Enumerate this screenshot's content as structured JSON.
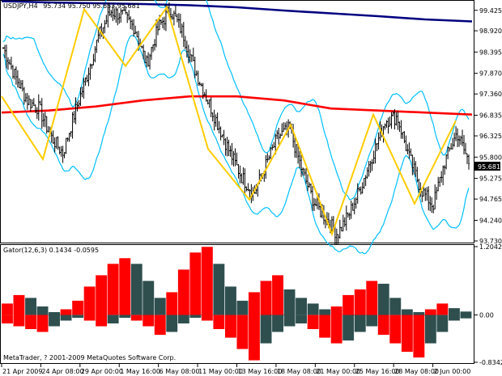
{
  "window": {
    "title": "USDJPY,H4",
    "quote": "95.734 95.750 95.653 95.681",
    "copyright": "MetaTrader, ? 2001-2009 MetaQuotes Software Corp."
  },
  "colors": {
    "background": "#ffffff",
    "bull_bar": "#000000",
    "bear_bar": "#000000",
    "envelope": "#00bfff",
    "slow_ma": "#000080",
    "mid_ma": "#ff0000",
    "zigzag": "#ffcc00",
    "gator_up": "#ff0000",
    "gator_down": "#2f4f4f",
    "price_box": "#000000"
  },
  "price_axis": {
    "ticks": [
      "99.425",
      "98.920",
      "98.395",
      "97.870",
      "97.360",
      "96.835",
      "96.325",
      "95.800",
      "95.275",
      "94.765",
      "94.240",
      "93.730"
    ],
    "current": "95.681"
  },
  "gator_axis": {
    "title": "Gator(12,6,3) 0.1434 -0.0595",
    "ticks": [
      "1.2042",
      "0.00",
      "-0.8342"
    ]
  },
  "time_axis": {
    "labels": [
      "21 Apr 2009",
      "24 Apr 08:00",
      "29 Apr 00:00",
      "1 May 16:00",
      "6 May 08:00",
      "11 May 00:00",
      "13 May 16:00",
      "18 May 08:00",
      "21 May 00:00",
      "25 May 16:00",
      "28 May 08:00",
      "2 Jun 00:00"
    ]
  },
  "chart_data": [
    {
      "type": "candlestick",
      "title": "USDJPY,H4",
      "ylim": [
        93.73,
        99.6
      ],
      "y_ticks": [
        99.425,
        98.92,
        98.395,
        97.87,
        97.36,
        96.835,
        96.325,
        95.8,
        95.275,
        94.765,
        94.24,
        93.73
      ],
      "close_path": [
        98.5,
        97.8,
        97.2,
        97.0,
        96.3,
        95.9,
        96.9,
        97.8,
        98.8,
        99.4,
        99.3,
        99.0,
        98.1,
        99.0,
        99.45,
        98.9,
        98.0,
        97.3,
        96.6,
        95.9,
        95.3,
        94.9,
        95.6,
        96.3,
        96.5,
        95.5,
        94.7,
        94.3,
        93.9,
        94.4,
        95.1,
        95.9,
        96.7,
        96.8,
        95.8,
        95.0,
        94.6,
        95.7,
        96.4,
        95.681
      ],
      "zigzag": [
        97.3,
        95.75,
        99.45,
        98.05,
        99.5,
        96.0,
        94.75,
        96.6,
        93.9,
        96.85,
        94.65,
        96.7
      ],
      "series": [
        {
          "name": "slow_ma",
          "values": [
            99.65,
            99.62,
            99.6,
            99.58,
            99.55,
            99.5,
            99.42,
            99.35,
            99.28,
            99.2,
            99.15
          ]
        },
        {
          "name": "mid_ma",
          "values": [
            96.9,
            96.95,
            97.05,
            97.2,
            97.3,
            97.3,
            97.2,
            97.0,
            96.95,
            96.9,
            96.85
          ]
        }
      ]
    },
    {
      "type": "bar",
      "title": "Gator(12,6,3) 0.1434 -0.0595",
      "ylim": [
        -0.8342,
        1.2042
      ],
      "y_ticks": [
        1.2042,
        0.0,
        -0.8342
      ],
      "upper": [
        0.2,
        0.35,
        0.3,
        0.15,
        0.05,
        0.1,
        0.25,
        0.5,
        0.7,
        0.9,
        1.0,
        0.9,
        0.6,
        0.3,
        0.4,
        0.8,
        1.1,
        1.2,
        0.9,
        0.5,
        0.25,
        0.4,
        0.6,
        0.7,
        0.45,
        0.3,
        0.2,
        0.1,
        0.15,
        0.35,
        0.45,
        0.6,
        0.55,
        0.3,
        0.1,
        0.05,
        0.1,
        0.2,
        0.12,
        0.06
      ],
      "lower": [
        -0.15,
        -0.2,
        -0.25,
        -0.3,
        -0.2,
        -0.1,
        -0.05,
        -0.1,
        -0.2,
        -0.15,
        -0.05,
        -0.1,
        -0.2,
        -0.35,
        -0.3,
        -0.15,
        -0.05,
        -0.1,
        -0.25,
        -0.4,
        -0.6,
        -0.8,
        -0.5,
        -0.3,
        -0.2,
        -0.15,
        -0.25,
        -0.4,
        -0.5,
        -0.45,
        -0.3,
        -0.2,
        -0.35,
        -0.5,
        -0.65,
        -0.75,
        -0.5,
        -0.3,
        -0.1,
        -0.06
      ]
    }
  ]
}
